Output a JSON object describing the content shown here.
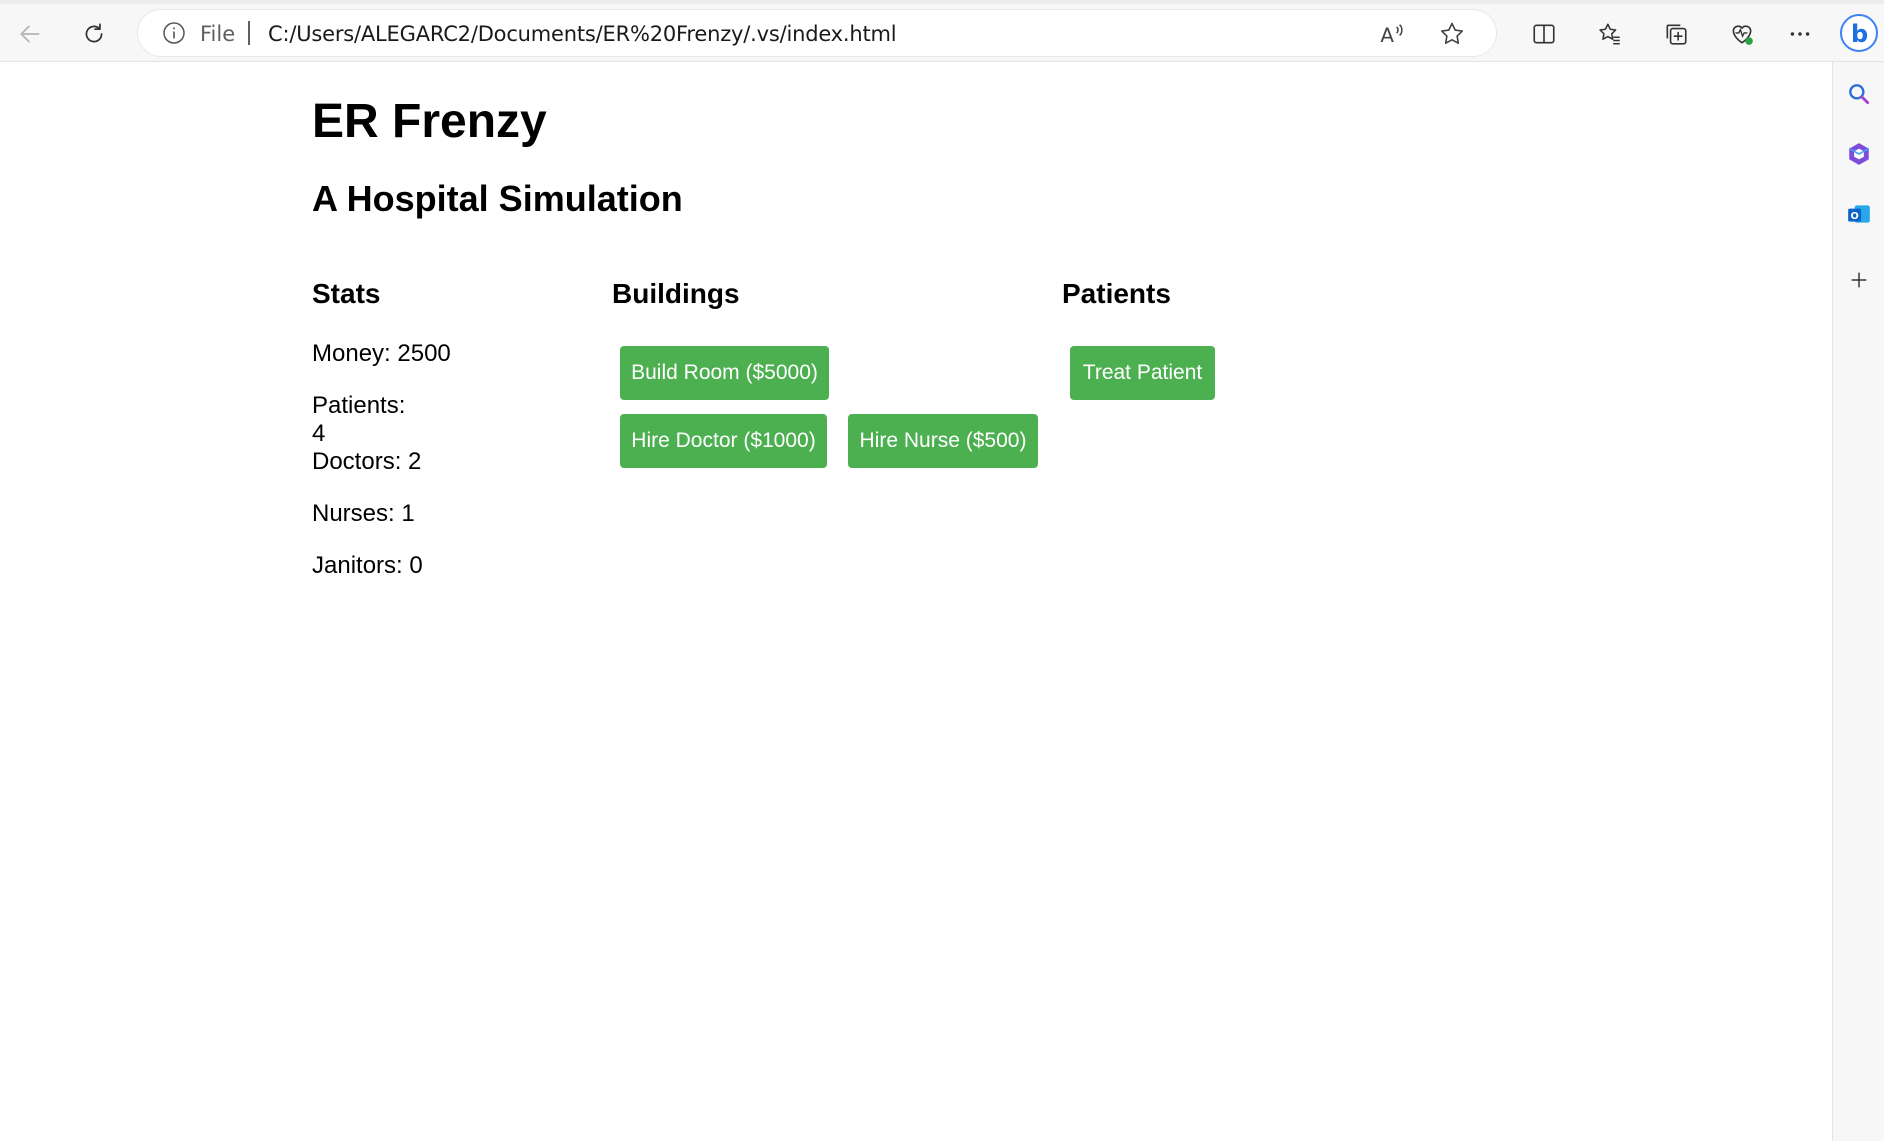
{
  "browser": {
    "url_prefix": "File",
    "url": "C:/Users/ALEGARC2/Documents/ER%20Frenzy/.vs/index.html",
    "icons": [
      "back-icon",
      "refresh-icon",
      "info-icon",
      "read-aloud-icon",
      "favorite-star-icon",
      "split-screen-icon",
      "favorites-icon",
      "collections-icon",
      "browser-essentials-icon",
      "more-icon",
      "copilot-icon"
    ],
    "sidebar_icons": [
      "search-icon",
      "office-icon",
      "outlook-icon",
      "add-icon"
    ]
  },
  "page": {
    "title": "ER Frenzy",
    "subtitle": "A Hospital Simulation"
  },
  "stats": {
    "heading": "Stats",
    "money": "Money: 2500",
    "patients_label": "Patients:",
    "patients_value": "4",
    "doctors": "Doctors: 2",
    "nurses": "Nurses: 1",
    "janitors": "Janitors: 0"
  },
  "buildings": {
    "heading": "Buildings",
    "build_room": "Build Room ($5000)",
    "hire_doctor": "Hire Doctor ($1000)",
    "hire_nurse": "Hire Nurse ($500)"
  },
  "patients": {
    "heading": "Patients",
    "treat_patient": "Treat Patient"
  },
  "colors": {
    "button": "#4caf50",
    "button_text": "#ffffff"
  }
}
